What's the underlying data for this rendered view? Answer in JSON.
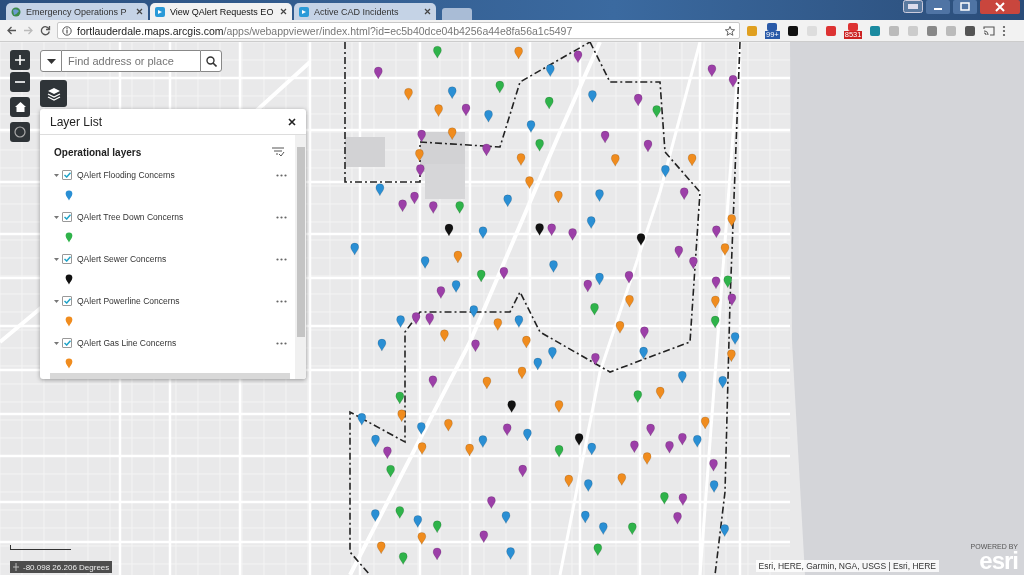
{
  "browser": {
    "tabs": [
      {
        "title": "Emergency Operations P",
        "selected": false
      },
      {
        "title": "View QAlert Requests EO",
        "selected": true
      },
      {
        "title": "Active CAD Incidents",
        "selected": false
      }
    ],
    "address_bar": {
      "host": "fortlauderdale.maps.arcgis.com",
      "path": "/apps/webappviewer/index.html?id=ec5b40dce04b4256a44e8fa56a1c5497"
    },
    "extension_badges": [
      "99+",
      "8531"
    ]
  },
  "map": {
    "search": {
      "placeholder": "Find address or place"
    },
    "layer_list": {
      "title": "Layer List",
      "section": "Operational layers",
      "layers": [
        {
          "name": "QAlert Flooding Concerns",
          "checked": true,
          "color": "#2a8fd4"
        },
        {
          "name": "QAlert Tree Down Concerns",
          "checked": true,
          "color": "#2fb34a"
        },
        {
          "name": "QAlert Sewer Concerns",
          "checked": true,
          "color": "#111111"
        },
        {
          "name": "QAlert Powerline Concerns",
          "checked": true,
          "color": "#f08c1e"
        },
        {
          "name": "QAlert Gas Line Concerns",
          "checked": true,
          "color": "#f08c1e"
        }
      ]
    },
    "coordinates": "-80.098 26.206 Degrees",
    "attribution": "Esri, HERE, Garmin, NGA, USGS | Esri, HERE",
    "logo": {
      "caption": "POWERED BY",
      "wordmark": "esri"
    }
  }
}
